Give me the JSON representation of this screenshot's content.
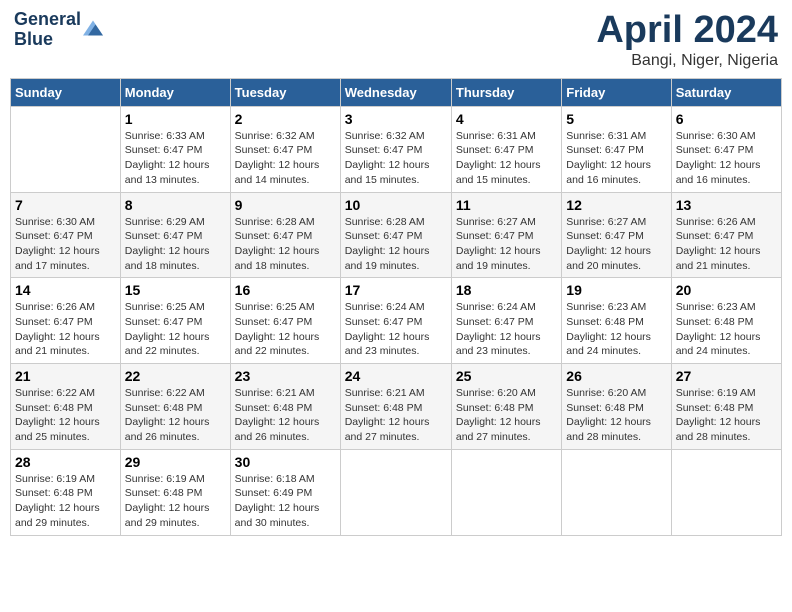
{
  "logo": {
    "line1": "General",
    "line2": "Blue"
  },
  "title": "April 2024",
  "subtitle": "Bangi, Niger, Nigeria",
  "days_header": [
    "Sunday",
    "Monday",
    "Tuesday",
    "Wednesday",
    "Thursday",
    "Friday",
    "Saturday"
  ],
  "weeks": [
    [
      {
        "day": "",
        "sunrise": "",
        "sunset": "",
        "daylight": ""
      },
      {
        "day": "1",
        "sunrise": "Sunrise: 6:33 AM",
        "sunset": "Sunset: 6:47 PM",
        "daylight": "Daylight: 12 hours and 13 minutes."
      },
      {
        "day": "2",
        "sunrise": "Sunrise: 6:32 AM",
        "sunset": "Sunset: 6:47 PM",
        "daylight": "Daylight: 12 hours and 14 minutes."
      },
      {
        "day": "3",
        "sunrise": "Sunrise: 6:32 AM",
        "sunset": "Sunset: 6:47 PM",
        "daylight": "Daylight: 12 hours and 15 minutes."
      },
      {
        "day": "4",
        "sunrise": "Sunrise: 6:31 AM",
        "sunset": "Sunset: 6:47 PM",
        "daylight": "Daylight: 12 hours and 15 minutes."
      },
      {
        "day": "5",
        "sunrise": "Sunrise: 6:31 AM",
        "sunset": "Sunset: 6:47 PM",
        "daylight": "Daylight: 12 hours and 16 minutes."
      },
      {
        "day": "6",
        "sunrise": "Sunrise: 6:30 AM",
        "sunset": "Sunset: 6:47 PM",
        "daylight": "Daylight: 12 hours and 16 minutes."
      }
    ],
    [
      {
        "day": "7",
        "sunrise": "Sunrise: 6:30 AM",
        "sunset": "Sunset: 6:47 PM",
        "daylight": "Daylight: 12 hours and 17 minutes."
      },
      {
        "day": "8",
        "sunrise": "Sunrise: 6:29 AM",
        "sunset": "Sunset: 6:47 PM",
        "daylight": "Daylight: 12 hours and 18 minutes."
      },
      {
        "day": "9",
        "sunrise": "Sunrise: 6:28 AM",
        "sunset": "Sunset: 6:47 PM",
        "daylight": "Daylight: 12 hours and 18 minutes."
      },
      {
        "day": "10",
        "sunrise": "Sunrise: 6:28 AM",
        "sunset": "Sunset: 6:47 PM",
        "daylight": "Daylight: 12 hours and 19 minutes."
      },
      {
        "day": "11",
        "sunrise": "Sunrise: 6:27 AM",
        "sunset": "Sunset: 6:47 PM",
        "daylight": "Daylight: 12 hours and 19 minutes."
      },
      {
        "day": "12",
        "sunrise": "Sunrise: 6:27 AM",
        "sunset": "Sunset: 6:47 PM",
        "daylight": "Daylight: 12 hours and 20 minutes."
      },
      {
        "day": "13",
        "sunrise": "Sunrise: 6:26 AM",
        "sunset": "Sunset: 6:47 PM",
        "daylight": "Daylight: 12 hours and 21 minutes."
      }
    ],
    [
      {
        "day": "14",
        "sunrise": "Sunrise: 6:26 AM",
        "sunset": "Sunset: 6:47 PM",
        "daylight": "Daylight: 12 hours and 21 minutes."
      },
      {
        "day": "15",
        "sunrise": "Sunrise: 6:25 AM",
        "sunset": "Sunset: 6:47 PM",
        "daylight": "Daylight: 12 hours and 22 minutes."
      },
      {
        "day": "16",
        "sunrise": "Sunrise: 6:25 AM",
        "sunset": "Sunset: 6:47 PM",
        "daylight": "Daylight: 12 hours and 22 minutes."
      },
      {
        "day": "17",
        "sunrise": "Sunrise: 6:24 AM",
        "sunset": "Sunset: 6:47 PM",
        "daylight": "Daylight: 12 hours and 23 minutes."
      },
      {
        "day": "18",
        "sunrise": "Sunrise: 6:24 AM",
        "sunset": "Sunset: 6:47 PM",
        "daylight": "Daylight: 12 hours and 23 minutes."
      },
      {
        "day": "19",
        "sunrise": "Sunrise: 6:23 AM",
        "sunset": "Sunset: 6:48 PM",
        "daylight": "Daylight: 12 hours and 24 minutes."
      },
      {
        "day": "20",
        "sunrise": "Sunrise: 6:23 AM",
        "sunset": "Sunset: 6:48 PM",
        "daylight": "Daylight: 12 hours and 24 minutes."
      }
    ],
    [
      {
        "day": "21",
        "sunrise": "Sunrise: 6:22 AM",
        "sunset": "Sunset: 6:48 PM",
        "daylight": "Daylight: 12 hours and 25 minutes."
      },
      {
        "day": "22",
        "sunrise": "Sunrise: 6:22 AM",
        "sunset": "Sunset: 6:48 PM",
        "daylight": "Daylight: 12 hours and 26 minutes."
      },
      {
        "day": "23",
        "sunrise": "Sunrise: 6:21 AM",
        "sunset": "Sunset: 6:48 PM",
        "daylight": "Daylight: 12 hours and 26 minutes."
      },
      {
        "day": "24",
        "sunrise": "Sunrise: 6:21 AM",
        "sunset": "Sunset: 6:48 PM",
        "daylight": "Daylight: 12 hours and 27 minutes."
      },
      {
        "day": "25",
        "sunrise": "Sunrise: 6:20 AM",
        "sunset": "Sunset: 6:48 PM",
        "daylight": "Daylight: 12 hours and 27 minutes."
      },
      {
        "day": "26",
        "sunrise": "Sunrise: 6:20 AM",
        "sunset": "Sunset: 6:48 PM",
        "daylight": "Daylight: 12 hours and 28 minutes."
      },
      {
        "day": "27",
        "sunrise": "Sunrise: 6:19 AM",
        "sunset": "Sunset: 6:48 PM",
        "daylight": "Daylight: 12 hours and 28 minutes."
      }
    ],
    [
      {
        "day": "28",
        "sunrise": "Sunrise: 6:19 AM",
        "sunset": "Sunset: 6:48 PM",
        "daylight": "Daylight: 12 hours and 29 minutes."
      },
      {
        "day": "29",
        "sunrise": "Sunrise: 6:19 AM",
        "sunset": "Sunset: 6:48 PM",
        "daylight": "Daylight: 12 hours and 29 minutes."
      },
      {
        "day": "30",
        "sunrise": "Sunrise: 6:18 AM",
        "sunset": "Sunset: 6:49 PM",
        "daylight": "Daylight: 12 hours and 30 minutes."
      },
      {
        "day": "",
        "sunrise": "",
        "sunset": "",
        "daylight": ""
      },
      {
        "day": "",
        "sunrise": "",
        "sunset": "",
        "daylight": ""
      },
      {
        "day": "",
        "sunrise": "",
        "sunset": "",
        "daylight": ""
      },
      {
        "day": "",
        "sunrise": "",
        "sunset": "",
        "daylight": ""
      }
    ]
  ]
}
